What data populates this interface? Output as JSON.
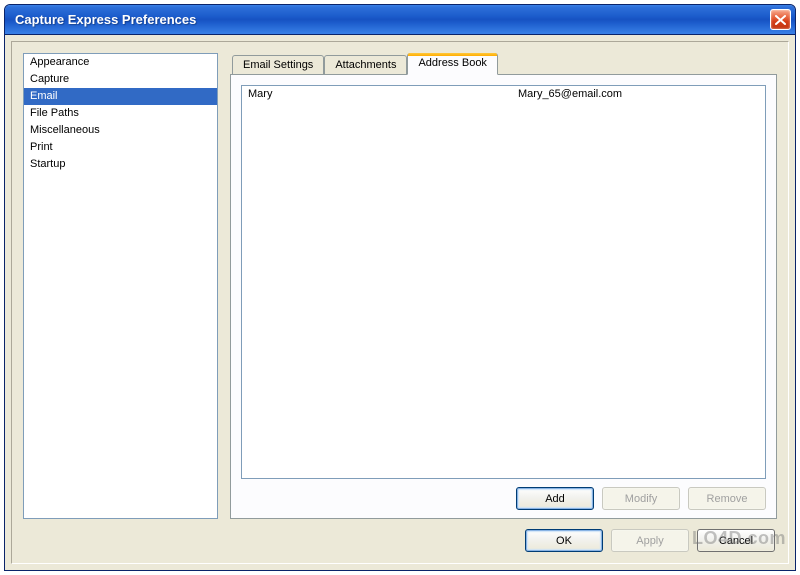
{
  "window": {
    "title": "Capture Express Preferences"
  },
  "sidebar": {
    "items": [
      {
        "label": "Appearance",
        "selected": false
      },
      {
        "label": "Capture",
        "selected": false
      },
      {
        "label": "Email",
        "selected": true
      },
      {
        "label": "File Paths",
        "selected": false
      },
      {
        "label": "Miscellaneous",
        "selected": false
      },
      {
        "label": "Print",
        "selected": false
      },
      {
        "label": "Startup",
        "selected": false
      }
    ]
  },
  "tabs": [
    {
      "label": "Email Settings",
      "active": false
    },
    {
      "label": "Attachments",
      "active": false
    },
    {
      "label": "Address Book",
      "active": true
    }
  ],
  "address_book": {
    "entries": [
      {
        "name": "Mary",
        "email": "Mary_65@email.com"
      }
    ],
    "buttons": {
      "add": "Add",
      "modify": "Modify",
      "remove": "Remove"
    }
  },
  "footer": {
    "ok": "OK",
    "apply": "Apply",
    "cancel": "Cancel"
  },
  "watermark": "LO4D.com"
}
